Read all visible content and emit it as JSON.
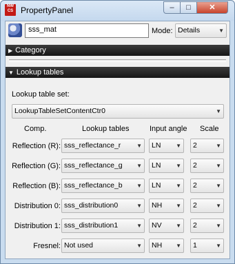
{
  "window": {
    "title": "PropertyPanel",
    "icon_text_line1": "NW",
    "icon_text_line2": "CS",
    "minimize_glyph": "–",
    "maximize_glyph": "□",
    "close_glyph": "✕"
  },
  "toolbar": {
    "object_name": "sss_mat",
    "mode_label": "Mode:",
    "mode_value": "Details"
  },
  "sections": {
    "category": "Category",
    "lookup_tables": "Lookup tables"
  },
  "lookup": {
    "set_label": "Lookup table set:",
    "set_value": "LookupTableSetContentCtr0",
    "headers": {
      "comp": "Comp.",
      "tables": "Lookup tables",
      "angle": "Input angle",
      "scale": "Scale"
    },
    "rows": [
      {
        "comp": "Reflection (R):",
        "table": "sss_reflectance_r",
        "angle": "LN",
        "scale": "2"
      },
      {
        "comp": "Reflection (G):",
        "table": "sss_reflectance_g",
        "angle": "LN",
        "scale": "2"
      },
      {
        "comp": "Reflection (B):",
        "table": "sss_reflectance_b",
        "angle": "LN",
        "scale": "2"
      },
      {
        "comp": "Distribution 0:",
        "table": "sss_distribution0",
        "angle": "NH",
        "scale": "2"
      },
      {
        "comp": "Distribution 1:",
        "table": "sss_distribution1",
        "angle": "NV",
        "scale": "2"
      },
      {
        "comp": "Fresnel:",
        "table": "Not used",
        "angle": "NH",
        "scale": "1"
      }
    ]
  },
  "icons": {
    "app": "nwcs-app-icon",
    "object": "material-sphere-icon",
    "expanded": "triangle-down-icon",
    "collapsed": "triangle-right-icon",
    "dropdown": "chevron-down-icon"
  },
  "colors": {
    "frame": "#c9dcef",
    "header": "#202020",
    "close": "#c8432c",
    "app_icon": "#c31a16"
  }
}
